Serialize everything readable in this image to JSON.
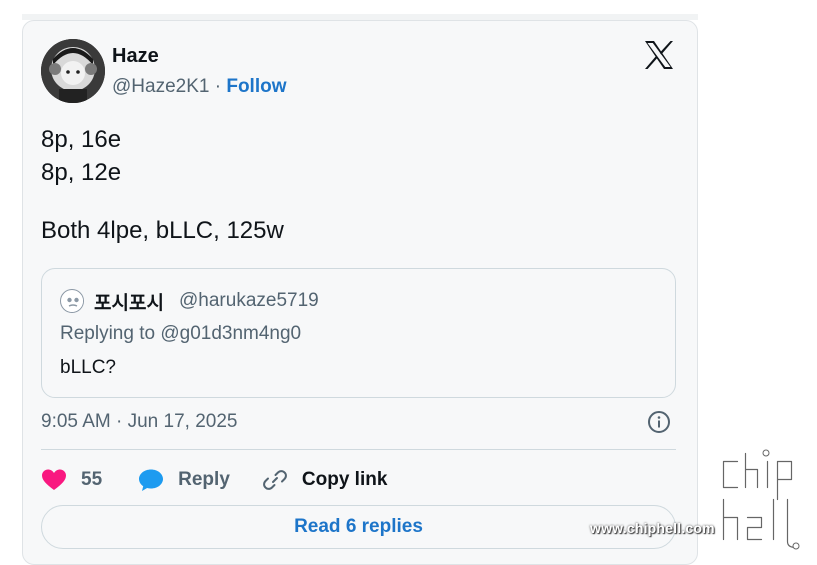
{
  "tweet": {
    "author": {
      "display_name": "Haze",
      "handle": "@Haze2K1",
      "separator": " · ",
      "follow_label": "Follow",
      "avatar_icon": "profile-avatar"
    },
    "platform_icon": "x-logo-icon",
    "text_lines": [
      "8p, 16e",
      "8p, 12e",
      "Both 4lpe, bLLC, 125w"
    ],
    "quoted_tweet": {
      "display_name": "포시포시",
      "handle": "@harukaze5719",
      "replying_to": "Replying to @g01d3nm4ng0",
      "text": "bLLC?"
    },
    "timestamp": "9:05 AM · Jun 17, 2025",
    "actions": {
      "like_count": "55",
      "reply_label": "Reply",
      "copy_link_label": "Copy link"
    },
    "read_replies_label": "Read 6 replies"
  },
  "watermark": {
    "url": "www.chiphell.com",
    "logo_text": "chip hell"
  },
  "colors": {
    "card_background": "#f7f8f9",
    "link_blue": "#1d75c9",
    "heart_pink": "#f91880",
    "reply_blue": "#1d9bf0",
    "muted_text": "#536471",
    "primary_text": "#0f1419",
    "border": "#cfd9de"
  }
}
